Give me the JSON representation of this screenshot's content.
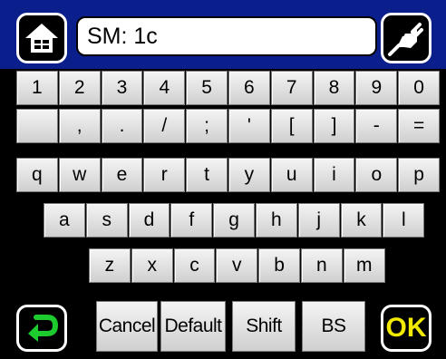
{
  "top_bar": {
    "home_icon": "home-icon",
    "input_value": "SM: 1c",
    "power_icon": "plug-icon"
  },
  "keyboard": {
    "rows": [
      [
        "1",
        "2",
        "3",
        "4",
        "5",
        "6",
        "7",
        "8",
        "9",
        "0"
      ],
      [
        "",
        ",",
        ".",
        "/",
        ";",
        "'",
        "[",
        "]",
        "-",
        "="
      ],
      [
        "q",
        "w",
        "e",
        "r",
        "t",
        "y",
        "u",
        "i",
        "o",
        "p"
      ],
      [
        "a",
        "s",
        "d",
        "f",
        "g",
        "h",
        "j",
        "k",
        "l"
      ],
      [
        "z",
        "x",
        "c",
        "v",
        "b",
        "n",
        "m"
      ]
    ]
  },
  "bottom_bar": {
    "enter_icon": "enter-arrow-icon",
    "cancel_label": "Cancel",
    "default_label": "Default",
    "shift_label": "Shift",
    "bs_label": "BS",
    "ok_label": "OK"
  },
  "colors": {
    "top_bar": "#0a1e8c",
    "background": "#000000",
    "enter_arrow": "#1ecb2e",
    "ok_text": "#f2ea00"
  }
}
